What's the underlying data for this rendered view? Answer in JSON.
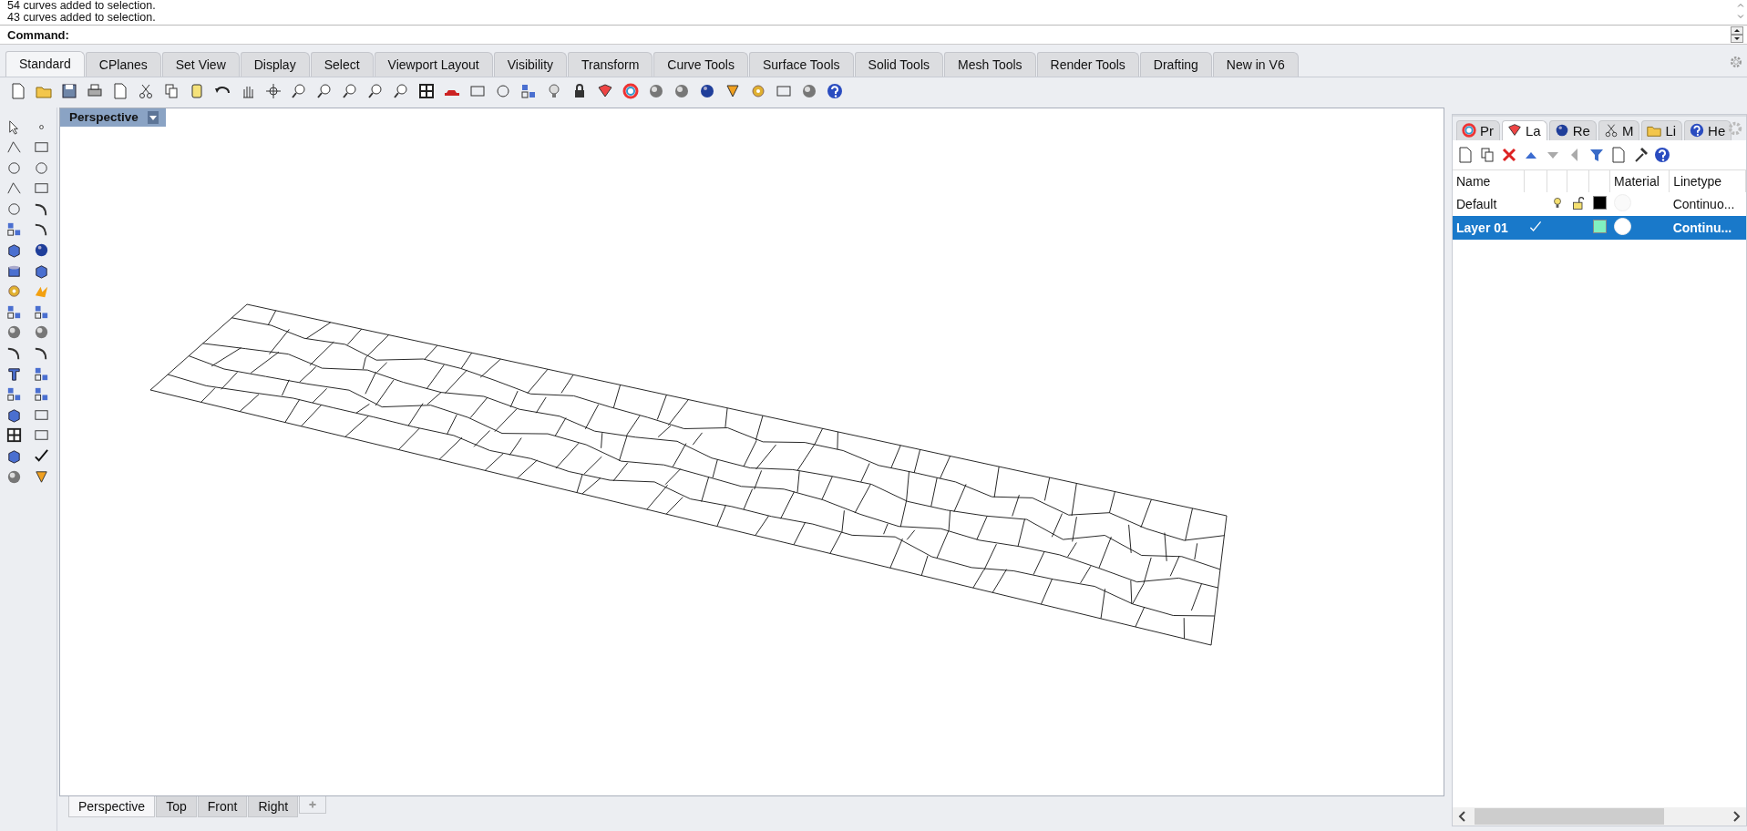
{
  "command_history": [
    "54 curves added to selection.",
    "43 curves added to selection."
  ],
  "command_prompt": {
    "label": "Command:"
  },
  "toolbar_tabs": [
    {
      "label": "Standard",
      "selected": true
    },
    {
      "label": "CPlanes",
      "selected": false
    },
    {
      "label": "Set View",
      "selected": false
    },
    {
      "label": "Display",
      "selected": false
    },
    {
      "label": "Select",
      "selected": false
    },
    {
      "label": "Viewport Layout",
      "selected": false
    },
    {
      "label": "Visibility",
      "selected": false
    },
    {
      "label": "Transform",
      "selected": false
    },
    {
      "label": "Curve Tools",
      "selected": false
    },
    {
      "label": "Surface Tools",
      "selected": false
    },
    {
      "label": "Solid Tools",
      "selected": false
    },
    {
      "label": "Mesh Tools",
      "selected": false
    },
    {
      "label": "Render Tools",
      "selected": false
    },
    {
      "label": "Drafting",
      "selected": false
    },
    {
      "label": "New in V6",
      "selected": false
    }
  ],
  "viewport": {
    "title": "Perspective"
  },
  "viewport_tabs": [
    {
      "label": "Perspective",
      "selected": true
    },
    {
      "label": "Top",
      "selected": false
    },
    {
      "label": "Front",
      "selected": false
    },
    {
      "label": "Right",
      "selected": false
    }
  ],
  "panel_tabs": [
    {
      "label": "Pr",
      "selected": false
    },
    {
      "label": "La",
      "selected": true
    },
    {
      "label": "Re",
      "selected": false
    },
    {
      "label": "M",
      "selected": false
    },
    {
      "label": "Li",
      "selected": false
    },
    {
      "label": "He",
      "selected": false
    }
  ],
  "layers": {
    "columns": [
      "Name",
      "Material",
      "Linetype"
    ],
    "rows": [
      {
        "name": "Default",
        "selected": false,
        "current": false,
        "color": "#000000",
        "linetype": "Continuo..."
      },
      {
        "name": "Layer 01",
        "selected": true,
        "current": true,
        "color": "#80f0c0",
        "linetype": "Continu..."
      }
    ]
  }
}
